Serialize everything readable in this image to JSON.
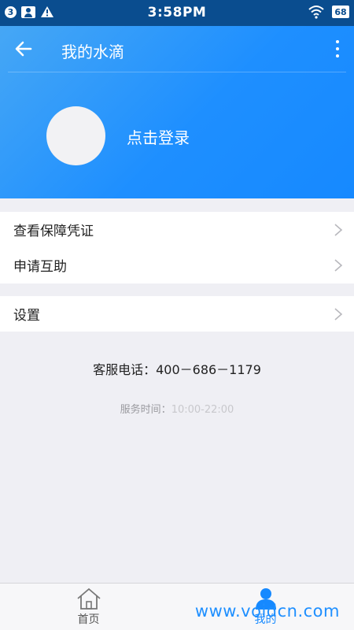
{
  "status_bar": {
    "notification_count": "3",
    "time": "3:58PM",
    "battery": "68",
    "icons": [
      "person-icon",
      "warning-icon",
      "wifi-icon"
    ]
  },
  "toolbar": {
    "title": "我的水滴",
    "back_icon": "arrow-left-icon",
    "more_icon": "more-vertical-icon"
  },
  "profile": {
    "login_label": "点击登录"
  },
  "menu": {
    "group1": [
      {
        "label": "查看保障凭证"
      },
      {
        "label": "申请互助"
      }
    ],
    "group2": [
      {
        "label": "设置"
      }
    ]
  },
  "contact": {
    "hotline": "客服电话：400－686－1179",
    "hours_label": "服务时间：",
    "hours_value": "10:00-22:00"
  },
  "tabs": [
    {
      "label": "首页",
      "icon": "home-icon",
      "active": false
    },
    {
      "label": "我的",
      "icon": "user-icon",
      "active": true
    }
  ],
  "watermark": "www.voidcn.com",
  "colors": {
    "accent": "#1689ff",
    "status_bar": "#0a4d8f",
    "background": "#efeff4"
  }
}
